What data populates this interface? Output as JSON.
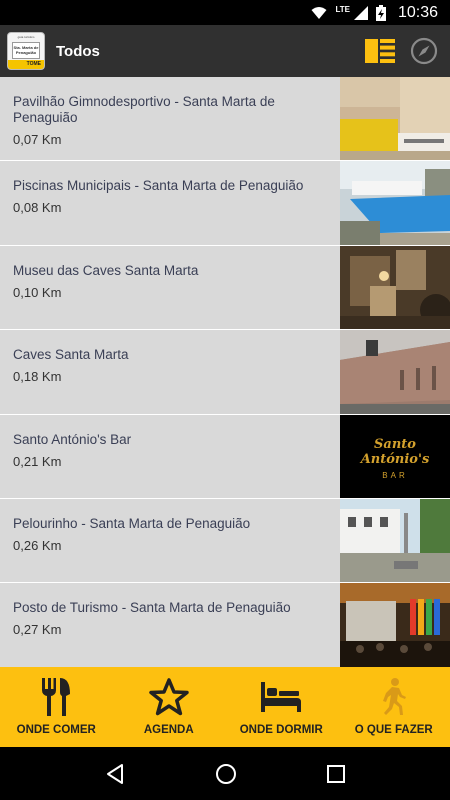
{
  "status_bar": {
    "network": "LTE",
    "time": "10:36",
    "icons": [
      "wifi-icon",
      "signal-icon",
      "battery-charging-icon"
    ]
  },
  "app_bar": {
    "logo": {
      "top_text": "guia turistico",
      "main_text": "Sta. Marta de Penaguião",
      "brand_text": "TOME"
    },
    "title": "Todos",
    "actions": [
      "list-view-icon",
      "compass-icon"
    ]
  },
  "places": [
    {
      "name": "Pavilhão Gimnodesportivo - Santa Marta de Penaguião",
      "distance": "0,07 Km",
      "thumb": "pavilion-photo"
    },
    {
      "name": "Piscinas Municipais - Santa Marta de Penaguião",
      "distance": "0,08 Km",
      "thumb": "pool-photo"
    },
    {
      "name": "Museu das Caves Santa Marta",
      "distance": "0,10 Km",
      "thumb": "museum-photo"
    },
    {
      "name": "Caves Santa Marta",
      "distance": "0,18 Km",
      "thumb": "caves-photo"
    },
    {
      "name": "Santo António's Bar",
      "distance": "0,21 Km",
      "thumb": "bar-logo-photo",
      "thumb_text": "Santo António's",
      "thumb_sub": "BAR"
    },
    {
      "name": "Pelourinho - Santa Marta de Penaguião",
      "distance": "0,26 Km",
      "thumb": "pillory-photo"
    },
    {
      "name": "Posto de Turismo - Santa Marta de Penaguião",
      "distance": "0,27 Km",
      "thumb": "tourism-office-photo"
    }
  ],
  "tabs": [
    {
      "label": "ONDE COMER",
      "icon": "fork-knife-icon"
    },
    {
      "label": "AGENDA",
      "icon": "star-icon"
    },
    {
      "label": "ONDE DORMIR",
      "icon": "bed-icon"
    },
    {
      "label": "O QUE FAZER",
      "icon": "walking-person-icon"
    }
  ],
  "colors": {
    "accent": "#fdc010",
    "app_bar": "#303030",
    "list_bg": "#d9d9d9",
    "text": "#3a3f55"
  }
}
